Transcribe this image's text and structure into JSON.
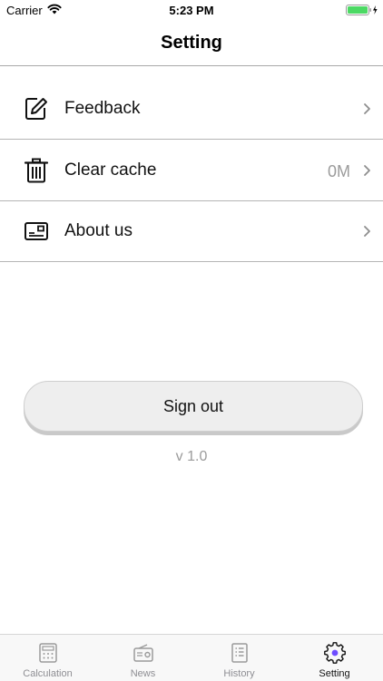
{
  "status_bar": {
    "carrier": "Carrier",
    "time": "5:23 PM",
    "wifi_icon": "wifi-icon",
    "battery_icon": "battery-charging-icon",
    "battery_color": "#4cd964"
  },
  "header": {
    "title": "Setting"
  },
  "settings": {
    "items": [
      {
        "label": "Feedback",
        "value": "",
        "icon": "edit-icon"
      },
      {
        "label": "Clear cache",
        "value": "0M",
        "icon": "trash-icon"
      },
      {
        "label": "About us",
        "value": "",
        "icon": "id-card-icon"
      }
    ]
  },
  "sign_out": {
    "label": "Sign out"
  },
  "version": "v 1.0",
  "tabbar": {
    "tabs": [
      {
        "label": "Calculation",
        "icon": "calculator-icon",
        "active": false
      },
      {
        "label": "News",
        "icon": "radio-icon",
        "active": false
      },
      {
        "label": "History",
        "icon": "list-icon",
        "active": false
      },
      {
        "label": "Setting",
        "icon": "gear-icon",
        "active": true
      }
    ],
    "accent_color": "#6e4cff"
  }
}
